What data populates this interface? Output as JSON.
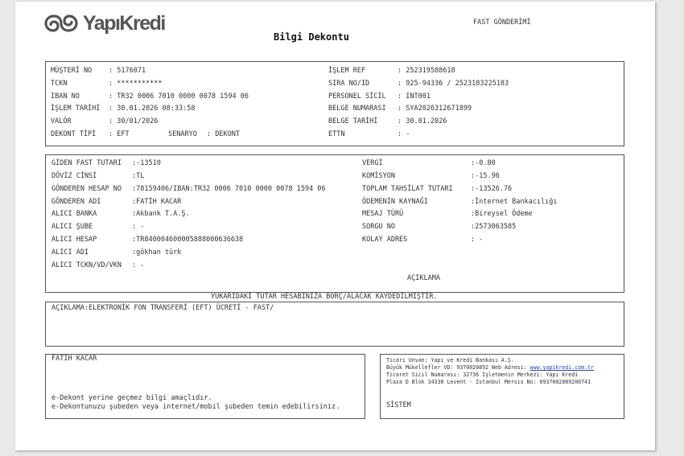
{
  "header": {
    "logo_text": "YapıKredi",
    "fast_label": "FAST GÖNDERİMİ",
    "title": "Bilgi Dekontu"
  },
  "box1": {
    "left": [
      {
        "label": "MÜŞTERİ NO",
        "value": ": 5176071"
      },
      {
        "label": "TCKN",
        "value": ": ***********"
      },
      {
        "label": "IBAN NO",
        "value": ": TR32 0006 7010 0000 0078 1594 06"
      },
      {
        "label": "İŞLEM TARİHİ",
        "value": ": 30.01.2026 08:33:58"
      },
      {
        "label": "VALÖR",
        "value": ": 30/01/2026"
      },
      {
        "label": "DEKONT TİPİ",
        "value": ": EFT"
      }
    ],
    "senaryo_label": "SENARYO",
    "senaryo_value": ": DEKONT",
    "right": [
      {
        "label": "İŞLEM REF",
        "value": ": 252319588618"
      },
      {
        "label": "SIRA NO/ID",
        "value": ": 925-94336 / 2523183225183"
      },
      {
        "label": "PERSONEL SİCİL",
        "value": ": INT001"
      },
      {
        "label": "BELGE NUMARASI",
        "value": ": SYA2026312671899"
      },
      {
        "label": "BELGE TARİHİ",
        "value": ": 30.01.2026"
      },
      {
        "label": "ETTN",
        "value": ": -"
      }
    ]
  },
  "box2": {
    "left": [
      {
        "label": "GİDEN FAST TUTARI",
        "value": ":-13510"
      },
      {
        "label": "DÖVİZ CİNSİ",
        "value": ":TL"
      },
      {
        "label": "GÖNDEREN HESAP NO",
        "value": ":78159406/IBAN:TR32 0006 7010 0000 0078 1594 06"
      },
      {
        "label": "GÖNDEREN ADI",
        "value": ":FATİH KACAR"
      },
      {
        "label": "ALICI BANKA",
        "value": ":Akbank T.A.Ş."
      },
      {
        "label": "ALICI ŞUBE",
        "value": ": -"
      },
      {
        "label": "ALICI HESAP",
        "value": ":TR840004600005888000636638"
      },
      {
        "label": "ALICI ADI",
        "value": ":gökhan türk"
      },
      {
        "label": "ALICI TCKN/VD/VKN",
        "value": ": -"
      }
    ],
    "right": [
      {
        "label": "VERGİ",
        "value": ":-0.80"
      },
      {
        "label": "KOMİSYON",
        "value": ":-15.96"
      },
      {
        "label": "TOPLAM TAHSİLAT TUTARI",
        "value": ":-13526.76"
      },
      {
        "label": "ÖDEMENİN KAYNAĞI",
        "value": ":İnternet Bankacılığı"
      },
      {
        "label": "MESAJ TÜRÜ",
        "value": ":Bireysel Ödeme"
      },
      {
        "label": "SORGU NO",
        "value": ":2573063585"
      },
      {
        "label": "KOLAY ADRES",
        "value": ": -"
      }
    ],
    "aciklama_heading": "AÇIKLAMA"
  },
  "notice": "YUKARIDAKİ TUTAR HESABINIZA BORÇ/ALACAK KAYDEDİLMİŞTİR.",
  "box3": {
    "description": "AÇIKLAMA:ELEKTRONİK FON TRANSFERİ (EFT) ÜCRETİ - FAST/"
  },
  "box4": {
    "name": "FATİH KACAR",
    "disclaimer1": "e-Dekont yerine geçmez bilgi amaçlıdır.",
    "disclaimer2": "e-Dekontunuzu şubeden veya internet/mobil şubeden temin edebilirsiniz."
  },
  "box5": {
    "line1": "Ticari Unvan: Yapı ve Kredi Bankası A.Ş.",
    "line2_prefix": "Büyük Mükellefler VD: 9370020892 Web Adresi: ",
    "line2_link": "www.yapikredi.com.tr",
    "line3": "Ticaret Sicil Numarası: 32736 İşletmenin Merkezi: Yapı Kredi",
    "line4": "Plaza D Blok 34330 Levent - İstanbul Mersis No: 0937002089200741",
    "sistem": "SİSTEM"
  }
}
